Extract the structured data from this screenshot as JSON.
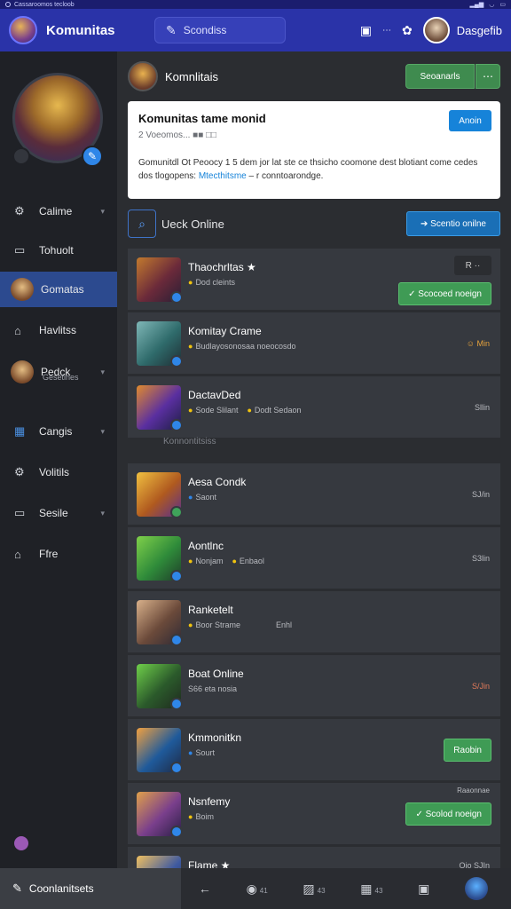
{
  "statusbar": {
    "text": "Cassaroomos tecloob"
  },
  "topbar": {
    "title": "Komunitas",
    "search_label": "Scondiss",
    "user_name": "Dasgefib"
  },
  "sidebar": {
    "items": [
      {
        "label": "Calime",
        "icon": "gear-icon",
        "has_chevron": true
      },
      {
        "label": "Tohuolt",
        "icon": "window-icon",
        "has_chevron": false
      },
      {
        "label": "Gomatas",
        "icon": "avatar",
        "has_chevron": false,
        "active": true
      },
      {
        "label": "Havlitss",
        "icon": "lock-icon",
        "has_chevron": false
      },
      {
        "label": "Pedck",
        "sub": "Gesetines",
        "icon": "avatar",
        "has_chevron": true
      },
      {
        "label": "Cangis",
        "icon": "calendar-icon",
        "has_chevron": true
      },
      {
        "label": "Volitils",
        "icon": "gear-icon",
        "has_chevron": false
      },
      {
        "label": "Sesile",
        "icon": "window-icon",
        "has_chevron": true
      },
      {
        "label": "Ffre",
        "icon": "home-icon",
        "has_chevron": false
      }
    ]
  },
  "community": {
    "name": "Komnlitais",
    "follow_label": "Seoanarls",
    "card": {
      "title": "Komunitas tame monid",
      "meta": "2 Voeomos... ■■ □□",
      "join_label": "Anoin",
      "description_pre": "Gomunitdl Ot Peoocy 1 5 dem jor lat ste ce thsicho coomone dest blotiant come cedes dos tlogopens: ",
      "description_link": "Mtecthitsme",
      "description_post": " – r conntoarondge."
    },
    "search_label": "Ueck Online",
    "online_btn": "➔ Scentio onilne",
    "divider_label": "Konnontitsiss"
  },
  "rows": [
    {
      "title": "Thaochrltas ★",
      "sub": "Dod cleints",
      "extra": "",
      "right": "",
      "button": "✓ Scocoed noeign",
      "top_ctl": "R ··",
      "thumb": "#6b2a3a",
      "badge": "#2f86e8"
    },
    {
      "title": "Komitay Crame",
      "sub": "Budlayosonosaa noeocosdo",
      "extra": "",
      "right": "☺ Min",
      "right_gold": true,
      "button": "",
      "thumb": "#2f6b6b",
      "badge": "#2f86e8"
    },
    {
      "title": "DactavDed",
      "sub": "Sode Slilant",
      "extra": "Dodt Sedaon",
      "right": "Sllin",
      "button": "",
      "thumb": "#5a2fa0",
      "badge": "#2f86e8"
    },
    {
      "title": "Aesa Condk",
      "sub": "Saont",
      "extra": "",
      "right": "SJ/in",
      "button": "",
      "thumb": "#b05a1f",
      "badge": "#3fa35a"
    },
    {
      "title": "Aontlnc",
      "sub": "Nonjam",
      "extra": "Enbaol",
      "right": "S3lin",
      "button": "",
      "thumb": "#2f8b3a",
      "badge": "#2f86e8"
    },
    {
      "title": "Ranketelt",
      "sub": "Boor Strame",
      "extra": "Enhl",
      "right": "",
      "button": "",
      "thumb": "#6b4a3a",
      "badge": "#2f86e8"
    },
    {
      "title": "Boat Online",
      "sub": "S66 eta nosia",
      "extra": "",
      "right": "S/Jin",
      "button": "",
      "thumb": "#2b5a2b",
      "badge": "#2f86e8"
    },
    {
      "title": "Kmmonitkn",
      "sub": "Sourt",
      "extra": "",
      "right": "",
      "button": "Raobin",
      "thumb": "#1f5a9b",
      "badge": "#2f86e8"
    },
    {
      "title": "Nsnfemy",
      "sub": "Boim",
      "extra": "",
      "right": "",
      "button": "✓ Scolod noeign",
      "top_small": "Raaonnae",
      "thumb": "#7a3f8c",
      "badge": "#2f86e8"
    },
    {
      "title": "Flame ★",
      "sub": "",
      "extra": "",
      "right": "Oio SJIn",
      "button": "",
      "thumb": "#3f5aa0",
      "badge": "#2f86e8"
    }
  ],
  "bottombar": {
    "tab_label": "Coonlanitsets",
    "items": [
      {
        "icon": "back-arrow-icon",
        "count": ""
      },
      {
        "icon": "chat-icon",
        "count": "41"
      },
      {
        "icon": "image-icon",
        "count": "43"
      },
      {
        "icon": "grid-icon",
        "count": "43"
      },
      {
        "icon": "apps-icon",
        "count": ""
      }
    ]
  },
  "colors": {
    "topbar": "#2a33a8",
    "sidebar": "#1f2126",
    "main": "#2b2d31",
    "row": "#36393f",
    "accent_blue": "#1683d9",
    "accent_green": "#3f9b55",
    "active_nav": "#2c4a8f"
  }
}
